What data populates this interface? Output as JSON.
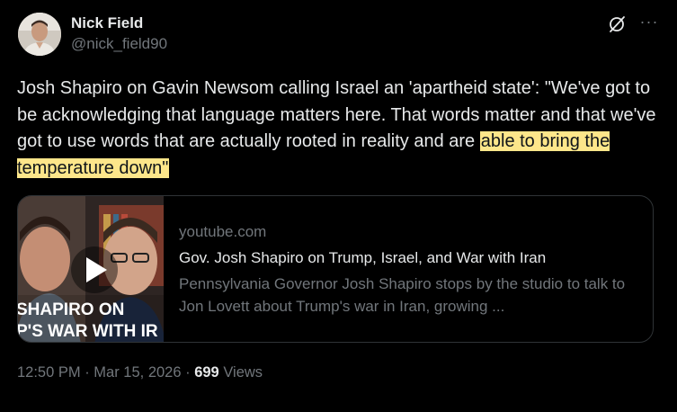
{
  "author": {
    "display_name": "Nick Field",
    "handle": "@nick_field90"
  },
  "actions": {
    "grok_icon": "grok-icon",
    "more_icon": "more-icon",
    "more_label": "···"
  },
  "tweet": {
    "text_main": "Josh Shapiro on Gavin Newsom calling Israel an 'apartheid state': \"We've got to be acknowledging that language matters here. That words matter and that we've got to use words that are actually rooted in reality and are ",
    "text_highlight": "able to bring the temperature down\""
  },
  "card": {
    "thumbnail_caption_line1": "SHAPIRO ON",
    "thumbnail_caption_line2": "P'S WAR WITH IR",
    "domain": "youtube.com",
    "title": "Gov. Josh Shapiro on Trump, Israel, and War with Iran",
    "description": "Pennsylvania Governor Josh Shapiro stops by the studio to talk to Jon Lovett about Trump's war in Iran, growing ..."
  },
  "meta": {
    "time": "12:50 PM",
    "separator": " · ",
    "date": "Mar 15, 2026",
    "views_count": "699",
    "views_label": " Views"
  },
  "colors": {
    "background": "#000000",
    "text": "#e7e9ea",
    "secondary": "#71767b",
    "highlight": "#fde68a",
    "border": "#2f3336"
  }
}
